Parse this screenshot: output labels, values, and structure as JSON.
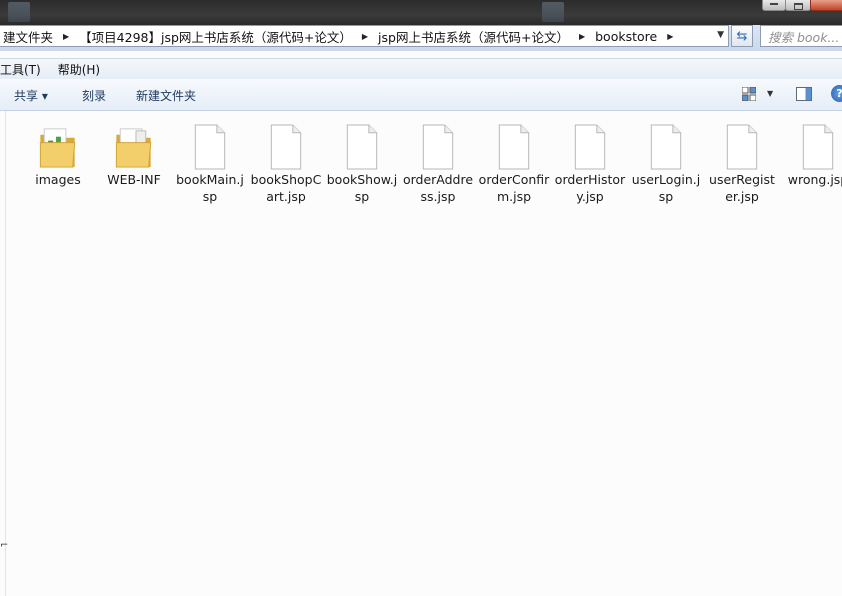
{
  "address_bar": {
    "crumbs": [
      "建文件夹",
      "【项目4298】jsp网上书店系统（源代码+论文）",
      "jsp网上书店系统（源代码+论文）",
      "bookstore"
    ]
  },
  "search": {
    "placeholder": "搜索 book..."
  },
  "menu": {
    "items": [
      "工具(T)",
      "帮助(H)"
    ]
  },
  "toolbar": {
    "share": "共享 ▾",
    "burn": "刻录",
    "new_folder": "新建文件夹"
  },
  "files": [
    {
      "name": "images",
      "type": "folder",
      "icon": "folder-images-icon"
    },
    {
      "name": "WEB-INF",
      "type": "folder",
      "icon": "folder-icon"
    },
    {
      "name": "bookMain.jsp",
      "type": "file",
      "icon": "file-icon"
    },
    {
      "name": "bookShopCart.jsp",
      "type": "file",
      "icon": "file-icon"
    },
    {
      "name": "bookShow.jsp",
      "type": "file",
      "icon": "file-icon"
    },
    {
      "name": "orderAddress.jsp",
      "type": "file",
      "icon": "file-icon"
    },
    {
      "name": "orderConfirm.jsp",
      "type": "file",
      "icon": "file-icon"
    },
    {
      "name": "orderHistory.jsp",
      "type": "file",
      "icon": "file-icon"
    },
    {
      "name": "userLogin.jsp",
      "type": "file",
      "icon": "file-icon"
    },
    {
      "name": "userRegister.jsp",
      "type": "file",
      "icon": "file-icon"
    },
    {
      "name": "wrong.jsp",
      "type": "file",
      "icon": "file-icon"
    }
  ],
  "colors": {
    "address_bg": "#cbd9ea",
    "toolbar_text": "#1e3a5f",
    "folder": "#f2cf6b"
  }
}
